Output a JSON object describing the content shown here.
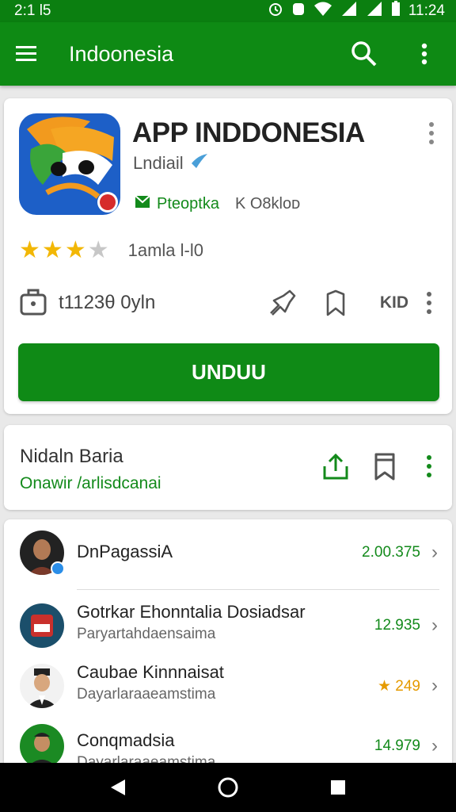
{
  "status_bar": {
    "time": "2:1 l5",
    "clock": "11:24"
  },
  "app_bar": {
    "title": "Indoonesia"
  },
  "app": {
    "title": "APP INDDONESIA",
    "developer": "Lndiail",
    "tag": "Pteoptka",
    "tag_extra": "K O8klоᴅ",
    "rating": 3.5,
    "rating_text": "1amla  l-l0",
    "size_text": "t1123θ 0уln",
    "kid_label": "KID",
    "install_label": "UNDUU"
  },
  "section": {
    "title": "Nidaln Baria",
    "subtitle": "Onawir /arlisdcanai"
  },
  "list": [
    {
      "name": "DnPagassiA",
      "sub": "",
      "value": "2.00.375"
    },
    {
      "name": "Gotrkar Ehonntalia Dosiadsar",
      "sub": "Paryartahdaensaima",
      "value": "12.935"
    },
    {
      "name": "Caubae Kinnnaisat",
      "sub": "Dayarlaraaeamstima",
      "value": "★ 249"
    },
    {
      "name": "Conqmadsia",
      "sub": "Dayarlaraaeamstima",
      "value": "14.979"
    }
  ],
  "colors": {
    "primary": "#0e8a14",
    "star": "#f2b705"
  }
}
